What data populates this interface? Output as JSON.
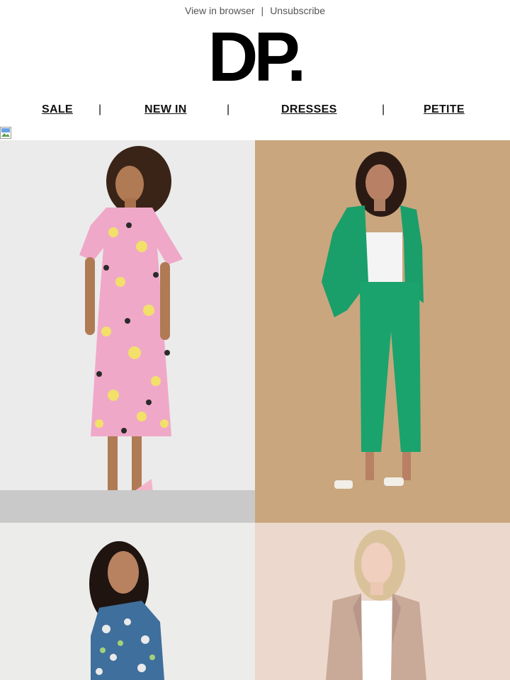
{
  "header": {
    "view_in_browser": "View in browser",
    "separator": "|",
    "unsubscribe": "Unsubscribe",
    "logo": "DP."
  },
  "nav": {
    "items": [
      {
        "label": "SALE"
      },
      {
        "label": "NEW IN"
      },
      {
        "label": "DRESSES"
      },
      {
        "label": "PETITE"
      }
    ],
    "separator": "|"
  },
  "banner": {
    "icon": "broken-image-icon"
  },
  "products": [
    {
      "image": "floral-midi-dress-photo",
      "dress_color": "#f0a8c8"
    },
    {
      "image": "green-suit-photo",
      "suit_color": "#1a9e6a"
    },
    {
      "image": "blue-floral-dress-photo",
      "dress_color": "#3f6f9c"
    },
    {
      "image": "beige-blazer-photo",
      "blazer_color": "#c9a998"
    }
  ]
}
